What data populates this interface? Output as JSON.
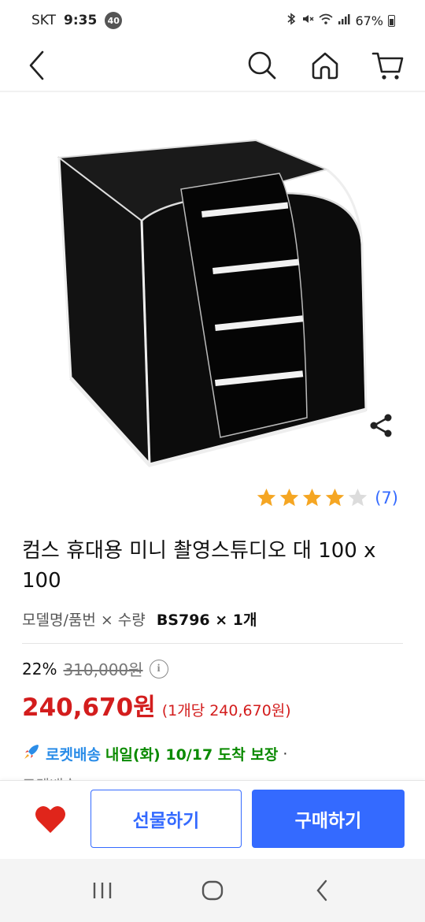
{
  "status_bar": {
    "carrier": "SKT",
    "time": "9:35",
    "notification_count": "40",
    "battery": "67%"
  },
  "nav": {
    "icons": [
      "back-icon",
      "search-icon",
      "home-icon",
      "cart-icon"
    ]
  },
  "product": {
    "rating": 4,
    "rating_max": 5,
    "review_count": "(7)",
    "title": "컴스 휴대용 미니 촬영스튜디오 대 100 x 100",
    "option_label": "모델명/품번 × 수량",
    "option_value": "BS796 × 1개",
    "discount_rate": "22%",
    "original_price": "310,000원",
    "sale_price": "240,670원",
    "unit_price": "(1개당 240,670원)"
  },
  "delivery": {
    "badge": "로켓배송",
    "text": "내일(화) 10/17 도착 보장",
    "separator": "·",
    "next_line": "로켓배송"
  },
  "actions": {
    "gift_label": "선물하기",
    "buy_label": "구매하기"
  },
  "colors": {
    "accent": "#346aff",
    "price": "#d31d1d",
    "delivery": "#0a8a00",
    "star": "#f5a623",
    "heart": "#e0251b"
  }
}
